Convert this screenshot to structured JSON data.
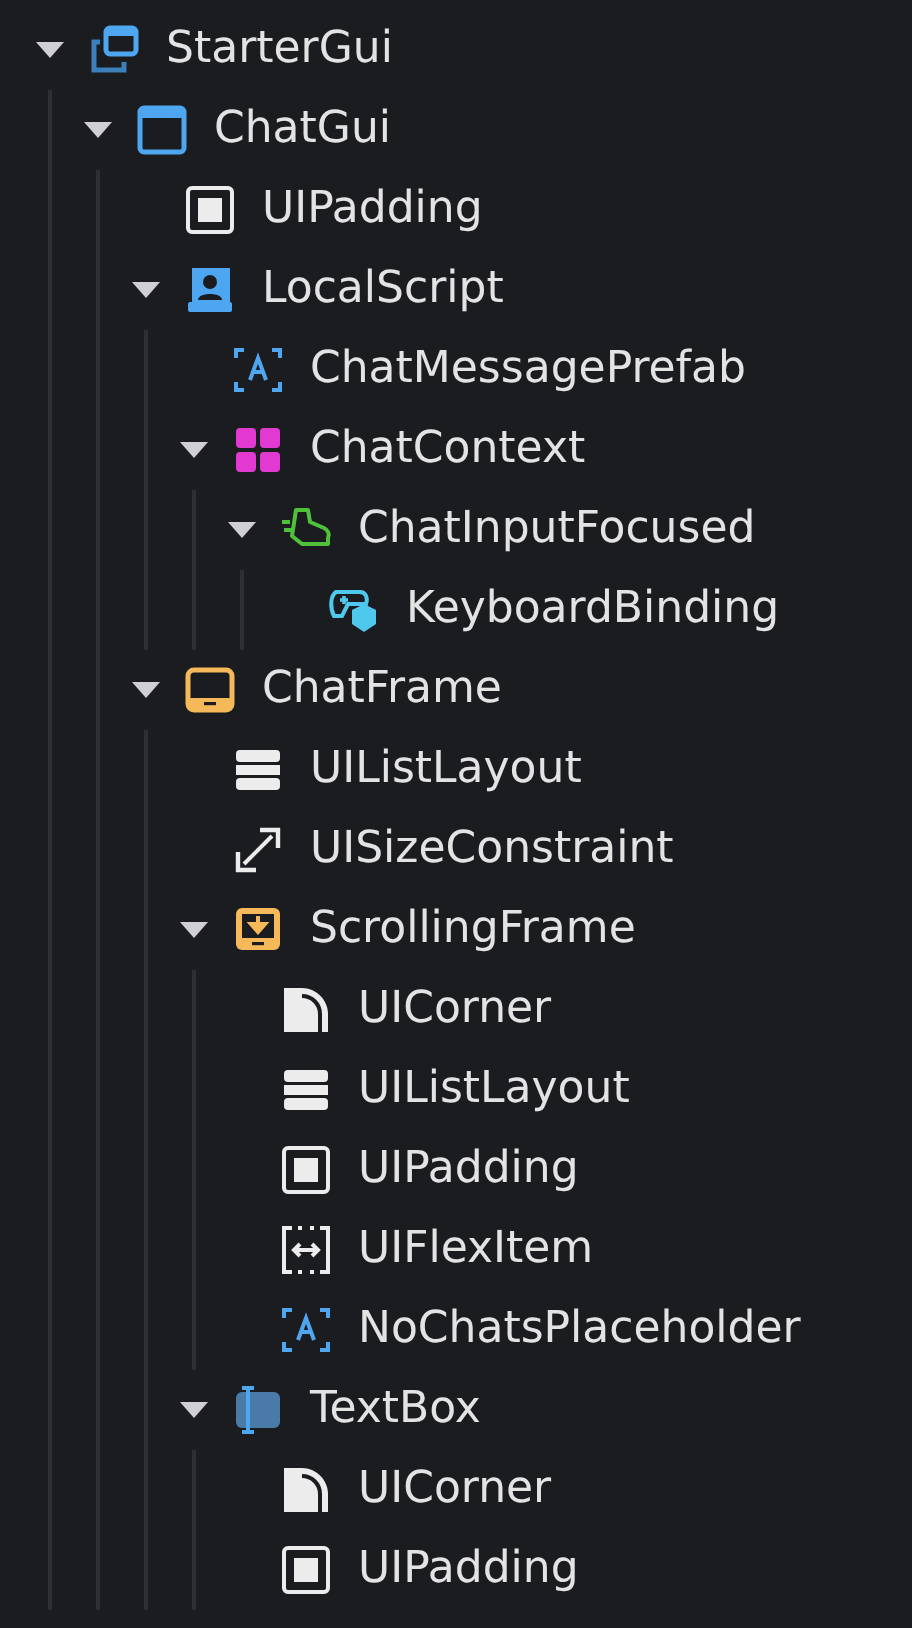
{
  "tree": [
    {
      "name": "StarterGui",
      "kind": "screen-gui",
      "expanded": true,
      "children": [
        {
          "name": "ChatGui",
          "kind": "gui",
          "expanded": true,
          "children": [
            {
              "name": "UIPadding",
              "kind": "padding"
            },
            {
              "name": "LocalScript",
              "kind": "script",
              "expanded": true,
              "children": [
                {
                  "name": "ChatMessagePrefab",
                  "kind": "text-label"
                },
                {
                  "name": "ChatContext",
                  "kind": "module",
                  "expanded": true,
                  "children": [
                    {
                      "name": "ChatInputFocused",
                      "kind": "shoe",
                      "expanded": true,
                      "children": [
                        {
                          "name": "KeyboardBinding",
                          "kind": "gamepad"
                        }
                      ]
                    }
                  ]
                }
              ]
            },
            {
              "name": "ChatFrame",
              "kind": "frame",
              "expanded": true,
              "children": [
                {
                  "name": "UIListLayout",
                  "kind": "list-layout"
                },
                {
                  "name": "UISizeConstraint",
                  "kind": "size-constraint"
                },
                {
                  "name": "ScrollingFrame",
                  "kind": "scrolling-frame",
                  "expanded": true,
                  "children": [
                    {
                      "name": "UICorner",
                      "kind": "corner"
                    },
                    {
                      "name": "UIListLayout",
                      "kind": "list-layout"
                    },
                    {
                      "name": "UIPadding",
                      "kind": "padding"
                    },
                    {
                      "name": "UIFlexItem",
                      "kind": "flex-item"
                    },
                    {
                      "name": "NoChatsPlaceholder",
                      "kind": "text-label"
                    }
                  ]
                },
                {
                  "name": "TextBox",
                  "kind": "text-box",
                  "expanded": true,
                  "children": [
                    {
                      "name": "UICorner",
                      "kind": "corner"
                    },
                    {
                      "name": "UIPadding",
                      "kind": "padding"
                    }
                  ]
                }
              ]
            }
          ]
        }
      ]
    }
  ]
}
